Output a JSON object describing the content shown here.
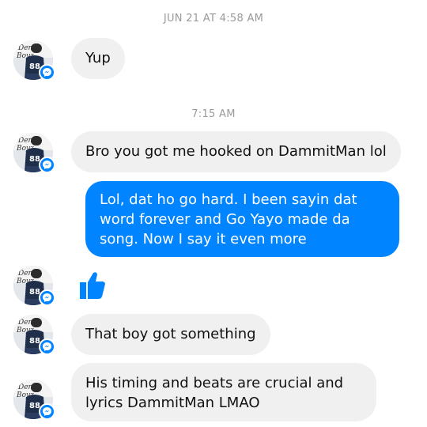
{
  "timestamps": {
    "first": "JUN 21 AT 4:58 AM",
    "second": "7:15 AM"
  },
  "contact": {
    "avatar_icon": "contact-photo",
    "badge_icon": "messenger-icon",
    "avatar_text": "Dem Boyz 88"
  },
  "messages": [
    {
      "direction": "incoming",
      "text": "Yup"
    },
    {
      "direction": "incoming",
      "text": "Bro you got me hooked on DammitMan lol"
    },
    {
      "direction": "outgoing",
      "text": "Lol, dat ho go hard. I been sayin dat word forever and Go Yayo made da song. Now I say it even more"
    },
    {
      "direction": "incoming",
      "sticker": "thumbs-up-icon"
    },
    {
      "direction": "incoming",
      "text": "That boy got something"
    },
    {
      "direction": "incoming",
      "text": "His timing and beats are crucial and lyrics DammitMan LMAO"
    }
  ],
  "colors": {
    "outgoing_bubble": "#0084ff",
    "incoming_bubble": "#f1f0f0",
    "timestamp": "#9a9a9a",
    "like": "#0084ff"
  }
}
